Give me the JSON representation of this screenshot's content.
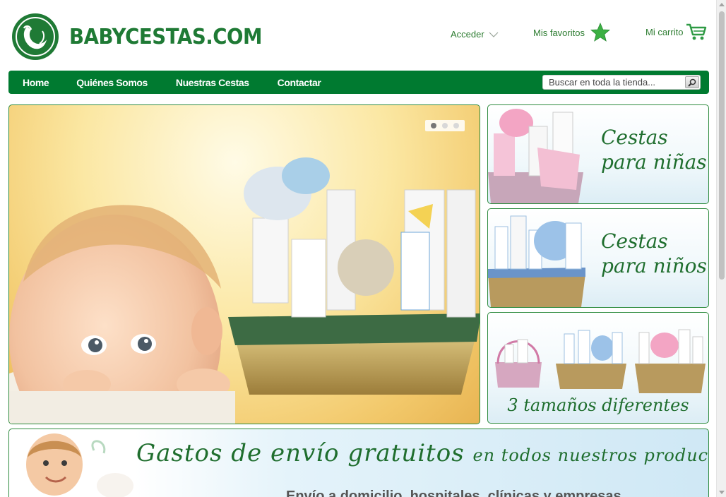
{
  "header": {
    "logo_text": "BABYCESTAS.COM",
    "login_label": "Acceder",
    "favorites_label": "Mis favoritos",
    "cart_label": "Mi carrito"
  },
  "nav": {
    "items": [
      {
        "label": "Home"
      },
      {
        "label": "Quiénes Somos"
      },
      {
        "label": "Nuestras Cestas"
      },
      {
        "label": "Contactar"
      }
    ],
    "search_placeholder": "Buscar en toda la tienda..."
  },
  "slider": {
    "dots": 3,
    "active_dot": 1
  },
  "side_banners": [
    {
      "line1": "Cestas",
      "line2": "para niñas"
    },
    {
      "line1": "Cestas",
      "line2": "para niños"
    },
    {
      "text": "3 tamaños diferentes"
    }
  ],
  "promo": {
    "title_main": "Gastos de envío gratuitos",
    "title_rest": "en todos nuestros productos",
    "subtitle": "Envío a domicilio, hospitales, clínicas y empresas"
  },
  "colors": {
    "brand_green": "#007a30",
    "text_green": "#1f7a35",
    "star_green": "#3cb043"
  },
  "icons": [
    "logo-swan-icon",
    "chevron-down-icon",
    "star-icon",
    "cart-icon",
    "search-icon"
  ]
}
